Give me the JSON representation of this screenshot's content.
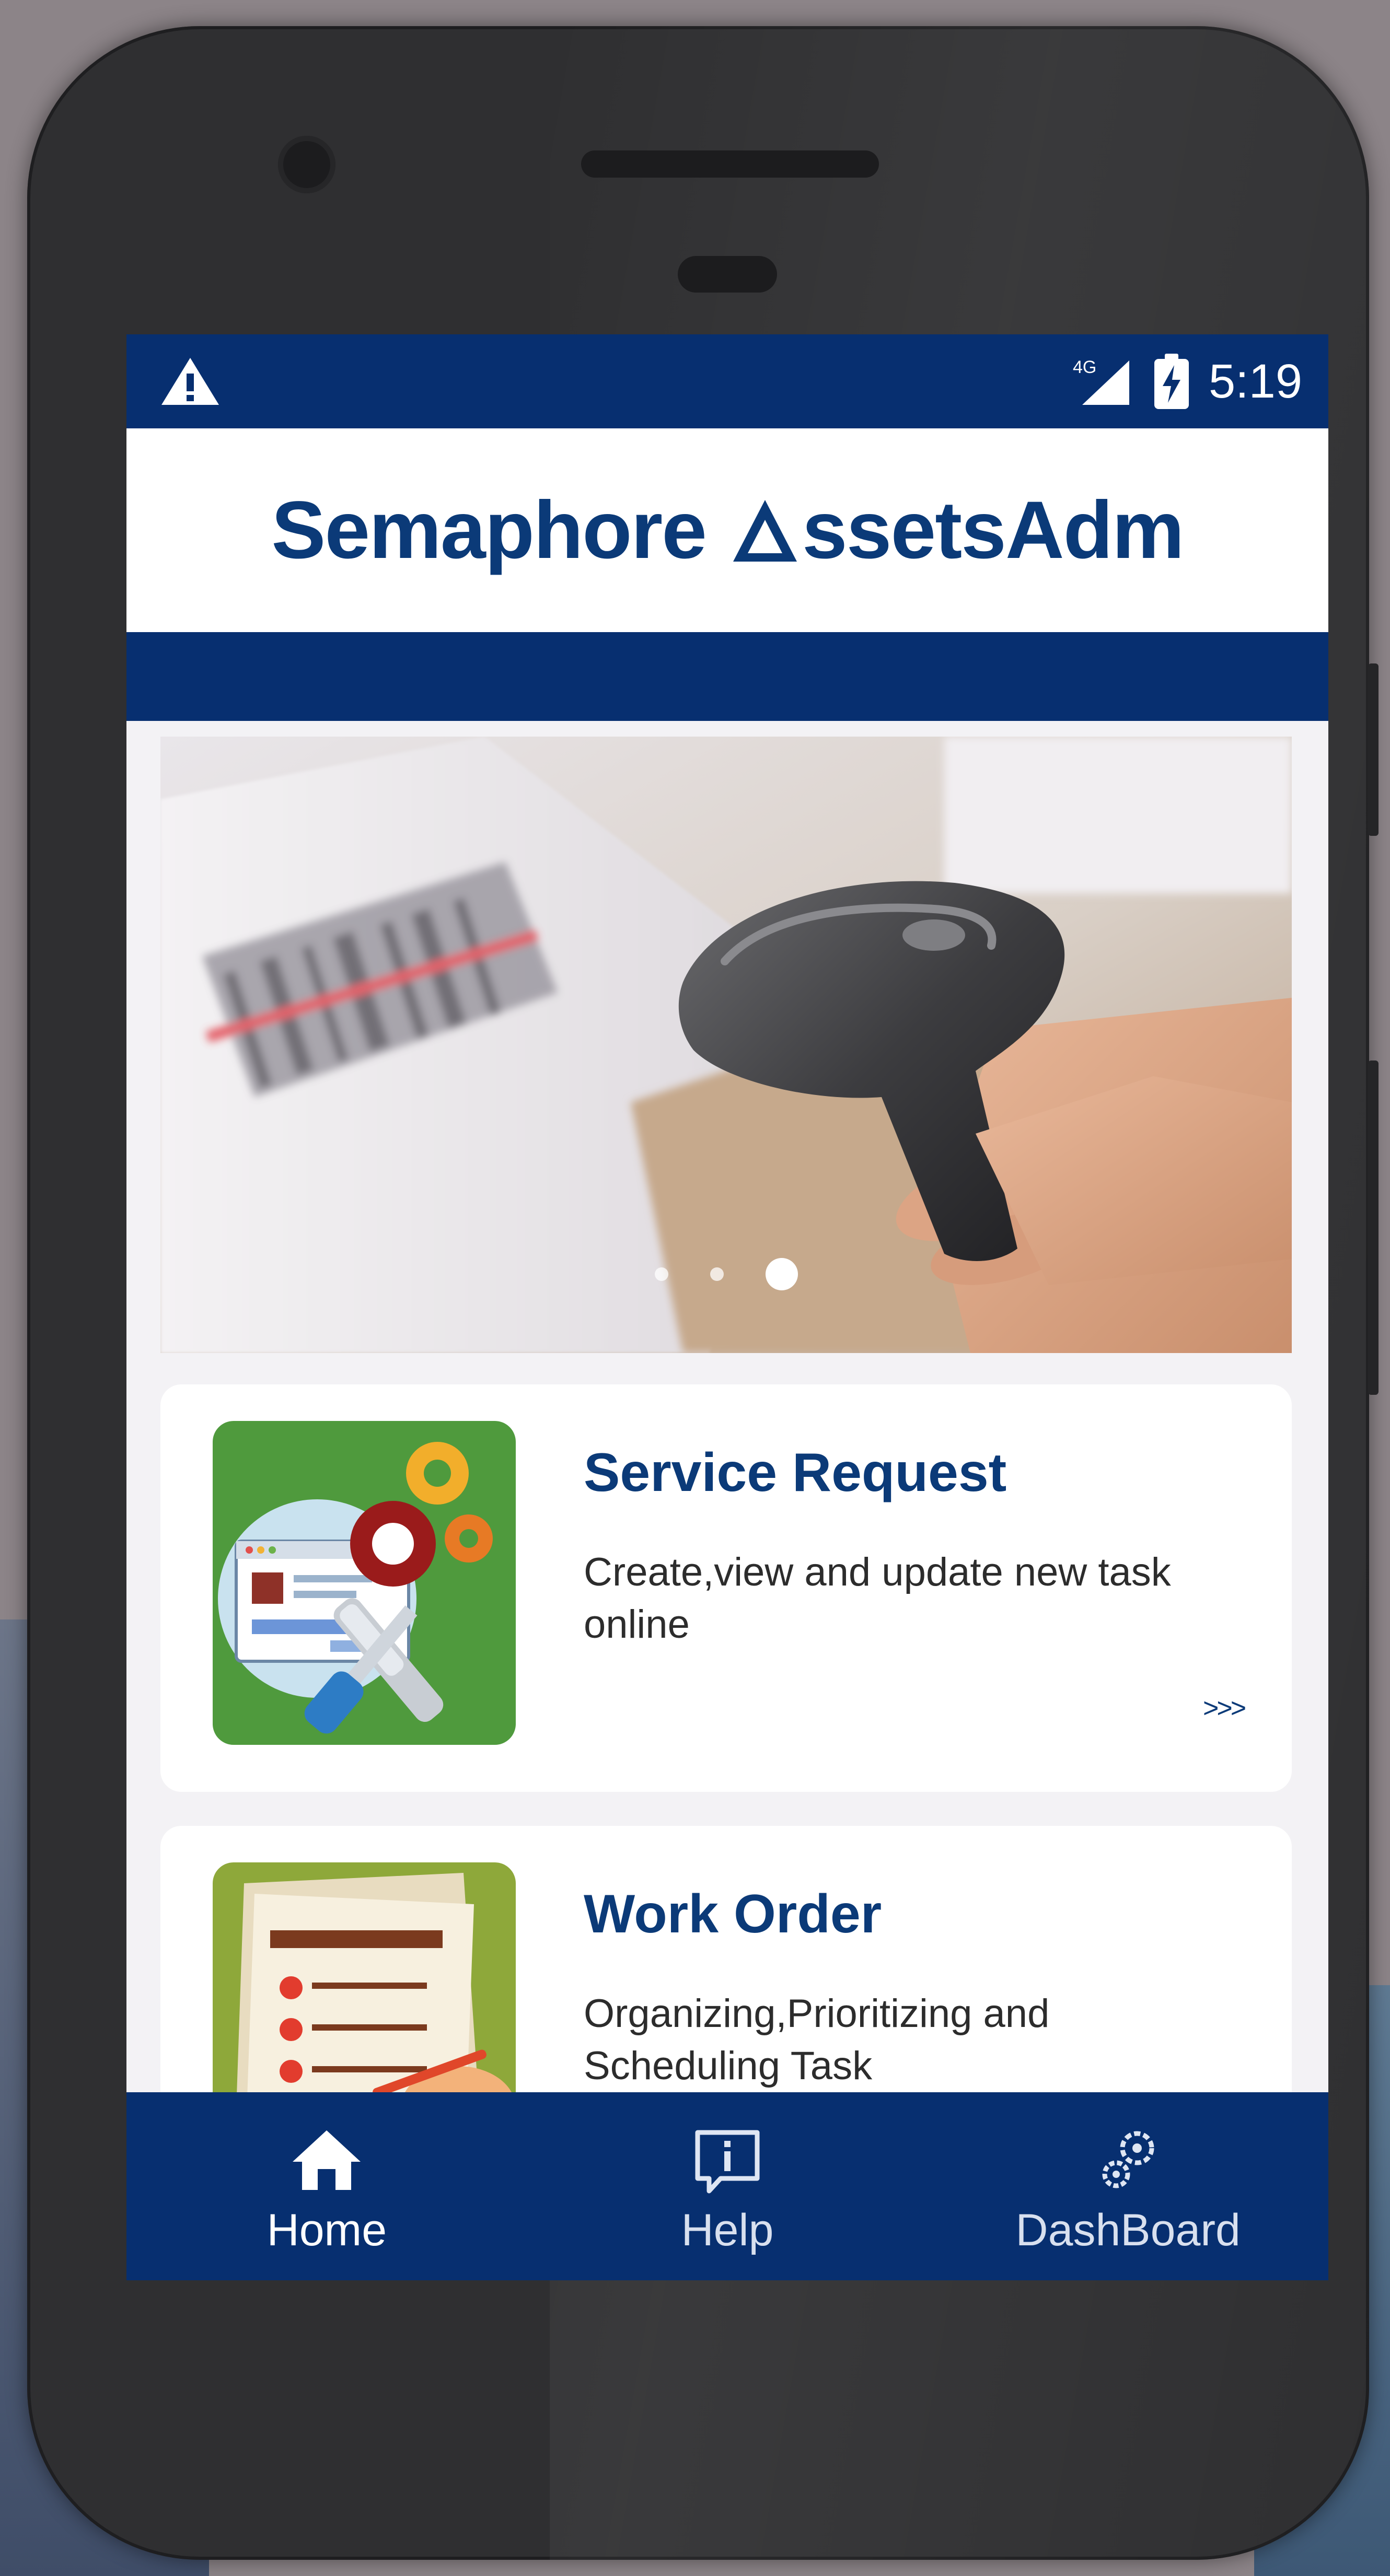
{
  "status_bar": {
    "network": "4G",
    "time": "5:19",
    "icons": [
      "warning-icon",
      "signal-icon",
      "battery-charging-icon"
    ]
  },
  "header": {
    "logo_word1": "Semaphore",
    "logo_word2": "ssetsAdm",
    "logo_mark": "a-triangle-logo"
  },
  "carousel": {
    "slide_count": 3,
    "active_index": 2,
    "image": "barcode-scanner-photo"
  },
  "cards": [
    {
      "title": "Service Request",
      "description": "Create,view and update new task online",
      "more": ">>>",
      "icon": "service-request-illustration"
    },
    {
      "title": "Work Order",
      "description": "Organizing,Prioritizing and Scheduling Task",
      "icon": "work-order-illustration"
    }
  ],
  "bottom_nav": {
    "items": [
      {
        "label": "Home",
        "icon": "home-icon",
        "active": true
      },
      {
        "label": "Help",
        "icon": "help-icon",
        "active": false
      },
      {
        "label": "DashBoard",
        "icon": "dashboard-icon",
        "active": false
      }
    ]
  },
  "colors": {
    "primary": "#072f70",
    "accent_text": "#0b3a78",
    "background": "#f3f2f5"
  }
}
